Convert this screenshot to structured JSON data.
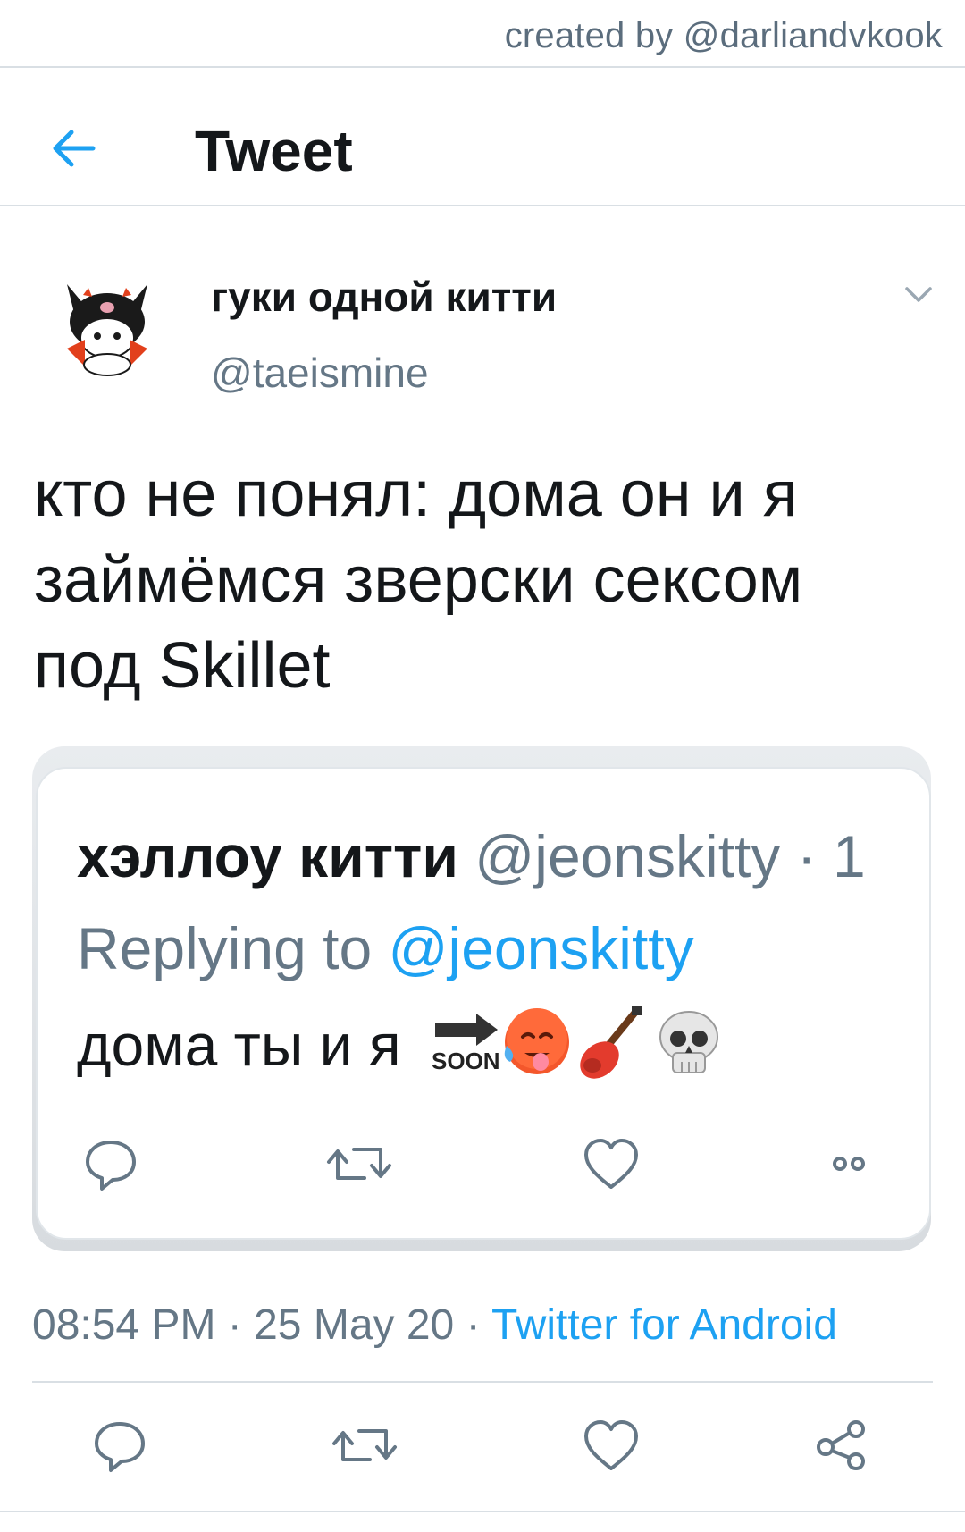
{
  "watermark": {
    "text": "created by @darliandvkook"
  },
  "header": {
    "title": "Tweet",
    "back_icon": "arrow-left-icon"
  },
  "tweet": {
    "author_name": "гуки одной китти",
    "author_handle": "@taeismine",
    "text": "кто не понял: дома он и я займёмся зверски сексом под Skillet",
    "time": "08:54 PM",
    "sep1": " · ",
    "date": "25 May 20",
    "sep2": " · ",
    "source": "Twitter for Android"
  },
  "quoted": {
    "author_name": "хэллоу китти",
    "author_handle": "@jeonskitty",
    "handle_tail": " · 1",
    "replying_prefix": "Replying to ",
    "replying_mention": "@jeonskitty",
    "text": "дома ты и я",
    "emojis": [
      "soon-arrow-icon",
      "hot-face-icon",
      "guitar-icon",
      "skull-icon"
    ]
  },
  "colors": {
    "accent": "#1da1f2",
    "text": "#14171a",
    "secondary": "#657786",
    "divider": "#d9dfe4"
  }
}
